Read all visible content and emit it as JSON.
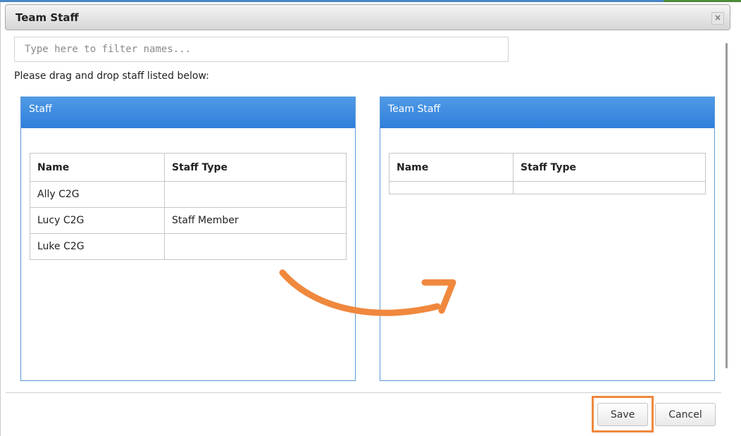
{
  "dialog": {
    "title": "Team Staff",
    "close_glyph": "×",
    "filter_placeholder": "Type here to filter names...",
    "instruction": "Please drag and drop staff listed below:"
  },
  "left_panel": {
    "title": "Staff",
    "columns": [
      "Name",
      "Staff Type"
    ],
    "rows": [
      {
        "name": "Ally C2G",
        "type": ""
      },
      {
        "name": "Lucy C2G",
        "type": "Staff Member"
      },
      {
        "name": "Luke C2G",
        "type": ""
      }
    ]
  },
  "right_panel": {
    "title": "Team Staff",
    "columns": [
      "Name",
      "Staff Type"
    ],
    "rows": []
  },
  "footer": {
    "save_label": "Save",
    "cancel_label": "Cancel"
  },
  "colors": {
    "panel_header": "#2f7fdb",
    "annotation_orange": "#f0883e"
  },
  "icons": [
    "close-icon",
    "drag-arrow-annotation"
  ]
}
